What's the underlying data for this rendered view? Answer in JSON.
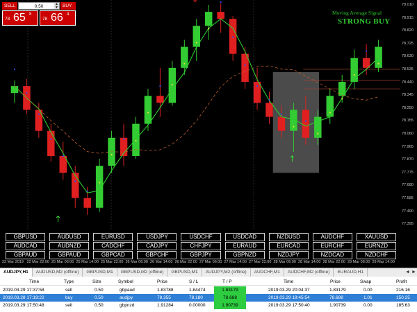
{
  "trade_panel": {
    "sell_label": "SELL",
    "buy_label": "BUY",
    "lot": "0.50",
    "sell_prefix": "78",
    "sell_big": "65",
    "sell_sup": "8",
    "buy_prefix": "78",
    "buy_big": "66",
    "buy_sup": "4"
  },
  "signal": {
    "title": "Moving Average Signal",
    "value": "STRONG BUY"
  },
  "price_axis": [
    "79.010",
    "78.915",
    "78.820",
    "78.725",
    "78.630",
    "78.535",
    "78.440",
    "78.345",
    "78.250",
    "78.155",
    "78.060",
    "77.965",
    "77.870",
    "77.775",
    "77.680",
    "77.585",
    "77.490",
    "77.395"
  ],
  "time_axis": [
    "22 Mar 2019",
    "22 Mar 22:00",
    "25 Mar 06:00",
    "25 Mar 14:00",
    "25 Mar 22:00",
    "26 Mar 06:00",
    "26 Mar 14:00",
    "26 Mar 22:00",
    "27 Mar 06:00",
    "27 Mar 14:00",
    "27 Mar 22:00",
    "28 Mar 06:00",
    "28 Mar 14:00",
    "28 Mar 22:00",
    "29 Mar 06:00",
    "29 Mar 14:00"
  ],
  "symbols": [
    "GBPUSD",
    "AUDUSD",
    "EURUSD",
    "USDJPY",
    "USDCHF",
    "USDCAD",
    "NZDUSD",
    "AUDCHF",
    "XAUUSD",
    "AUDCAD",
    "AUDNZD",
    "CADCHF",
    "CADJPY",
    "CHFJPY",
    "EURAUD",
    "EURCAD",
    "EURCHF",
    "EURNZD",
    "GBPAUD",
    "GBPAUD",
    "GBPCAD",
    "GBPCHF",
    "GBPJPY",
    "GBPNZD",
    "NZDJPY",
    "NZDCAD",
    "NZDCHF"
  ],
  "tabs": [
    "AUDJPY,H1",
    "AUDUSD,M2 (offline)",
    "GBPUSD,M1",
    "GBPUSD,M2 (offline)",
    "GBPUSD,M1",
    "AUDJPY,M2 (offline)",
    "AUDCHF,M1",
    "AUDCHF,M2 (offline)",
    "EURAUD,H1"
  ],
  "table": {
    "headers": {
      "time": "Time",
      "type": "Type",
      "size": "Size",
      "symbol": "Symbol",
      "price": "Price",
      "sl": "S / L",
      "tp": "T / P",
      "time2": "Time",
      "price2": "Price",
      "swap": "Swap",
      "profit": "Profit"
    },
    "rows": [
      {
        "time": "2019.03.29 17:37:58",
        "type": "sell",
        "size": "0.50",
        "symbol": "gbpaud",
        "price": "1.83788",
        "sl": "1.84474",
        "tp": "1.83179",
        "time2": "2019.03.29 20:04:37",
        "price2": "1.83179",
        "swap": "0.00",
        "profit": "216.16"
      },
      {
        "time": "2019.03.28 17:19:22",
        "type": "buy",
        "size": "0.50",
        "symbol": "audjpy",
        "price": "78.355",
        "sl": "78.180",
        "tp": "78.688",
        "time2": "2019.03.29 19:45:54",
        "price2": "78.688",
        "swap": "1.01",
        "profit": "150.25"
      },
      {
        "time": "2019.03.29 17:50:48",
        "type": "sell",
        "size": "0.50",
        "symbol": "gbpnzd",
        "price": "1.91284",
        "sl": "0.00000",
        "tp": "1.90739",
        "time2": "2019.03.29 17:50:40",
        "price2": "1.90739",
        "swap": "0.00",
        "profit": "185.63"
      }
    ]
  },
  "chart_data": {
    "type": "candlestick",
    "colors": {
      "bull": "#33cc33",
      "bear": "#e02020",
      "background": "#000000",
      "ma_fast": "#2ecc2e",
      "ma_slow_dash": "#c06030"
    },
    "candles": [
      [
        78.37,
        78.46,
        78.3,
        78.42
      ],
      [
        78.42,
        78.47,
        78.22,
        78.25
      ],
      [
        78.25,
        78.3,
        78.05,
        78.1
      ],
      [
        78.1,
        78.15,
        77.88,
        77.92
      ],
      [
        77.92,
        78.02,
        77.75,
        77.8
      ],
      [
        77.8,
        77.85,
        77.55,
        77.62
      ],
      [
        77.62,
        77.7,
        77.5,
        77.55
      ],
      [
        77.55,
        77.9,
        77.52,
        77.85
      ],
      [
        77.85,
        78.1,
        77.8,
        78.05
      ],
      [
        78.05,
        78.15,
        77.85,
        77.92
      ],
      [
        77.92,
        78.2,
        77.9,
        78.15
      ],
      [
        78.15,
        78.4,
        78.1,
        78.35
      ],
      [
        78.35,
        78.55,
        78.2,
        78.3
      ],
      [
        78.3,
        78.6,
        78.28,
        78.55
      ],
      [
        78.55,
        78.75,
        78.5,
        78.7
      ],
      [
        78.7,
        78.9,
        78.6,
        78.85
      ],
      [
        78.85,
        79.0,
        78.75,
        78.95
      ],
      [
        78.95,
        79.01,
        78.8,
        78.9
      ],
      [
        78.9,
        78.92,
        78.6,
        78.65
      ],
      [
        78.65,
        78.7,
        78.4,
        78.45
      ],
      [
        78.45,
        78.55,
        78.25,
        78.3
      ],
      [
        78.3,
        78.38,
        78.15,
        78.2
      ],
      [
        78.2,
        78.28,
        78.05,
        78.1
      ],
      [
        78.1,
        78.3,
        77.95,
        78.25
      ],
      [
        78.25,
        78.35,
        78.0,
        78.05
      ],
      [
        78.05,
        78.25,
        78.0,
        78.2
      ],
      [
        78.2,
        78.4,
        78.15,
        78.35
      ],
      [
        78.35,
        78.5,
        78.3,
        78.45
      ],
      [
        78.45,
        78.68,
        78.4,
        78.62
      ],
      [
        78.62,
        78.72,
        78.5,
        78.55
      ],
      [
        78.55,
        78.75,
        78.52,
        78.7
      ]
    ],
    "title": ""
  }
}
